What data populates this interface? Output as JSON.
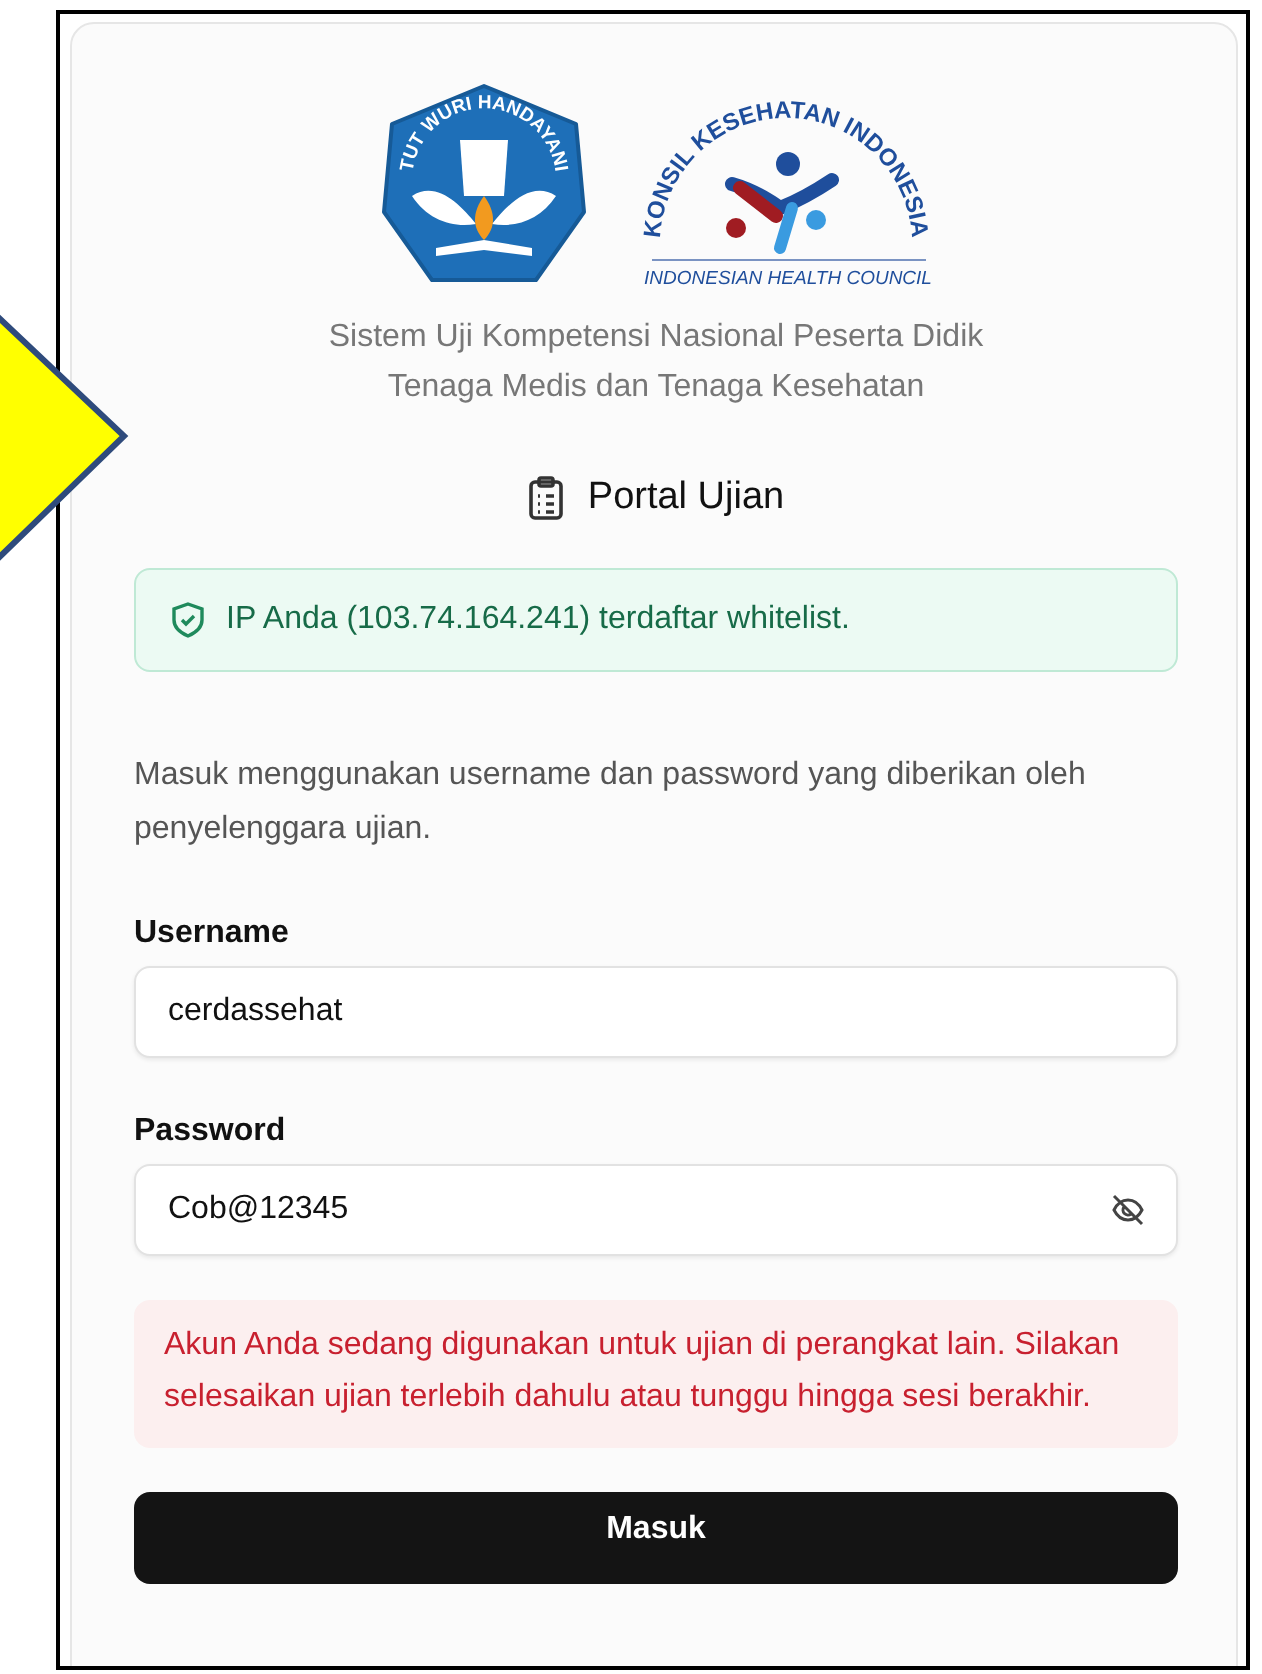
{
  "logos": {
    "left_ring_text": "TUT WURI HANDAYANI",
    "right_arc_text": "KONSIL KESEHATAN INDONESIA",
    "right_caption": "INDONESIAN HEALTH COUNCIL"
  },
  "subtitle_lines": [
    "Sistem Uji Kompetensi Nasional Peserta Didik",
    "Tenaga Medis dan Tenaga Kesehatan"
  ],
  "heading": "Portal Ujian",
  "whitelist_notice": "IP Anda (103.74.164.241) terdaftar whitelist.",
  "instructions": "Masuk menggunakan username dan password yang diberikan oleh penyelenggara ujian.",
  "fields": [
    {
      "kind": "text",
      "label": "Username",
      "value": "cerdassehat"
    },
    {
      "kind": "password",
      "label": "Password",
      "value": "Cob@12345",
      "revealed": true
    }
  ],
  "error_message": "Akun Anda sedang digunakan untuk ujian di perangkat lain. Silakan selesaikan ujian terlebih dahulu atau tunggu hingga sesi berakhir.",
  "submit_button": "Masuk"
}
